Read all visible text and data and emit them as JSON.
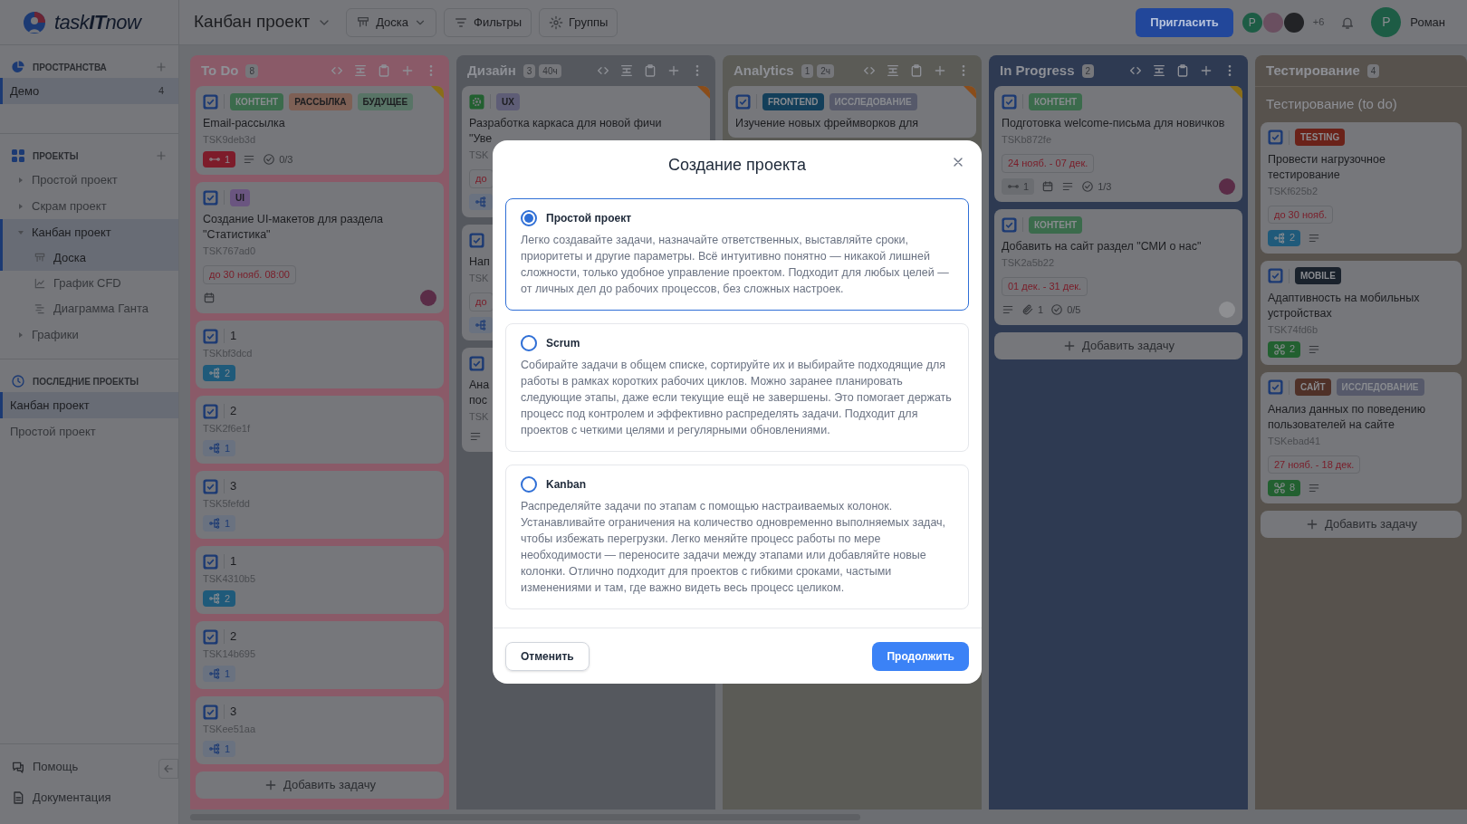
{
  "topbar": {
    "logo": "task**IT**now",
    "project_title": "Канбан проект",
    "view_button": "Доска",
    "filters_button": "Фильтры",
    "groups_button": "Группы",
    "invite_button": "Пригласить",
    "members": [
      {
        "kind": "letter",
        "text": "Р",
        "color": "#1d5c45"
      },
      {
        "kind": "photo",
        "color": "#6a4f60"
      },
      {
        "kind": "photo",
        "color": "#222326"
      }
    ],
    "more_members": "+6",
    "user": {
      "initial": "Р",
      "name": "Роман",
      "color": "#1d5c45"
    }
  },
  "sidebar": {
    "sections": [
      {
        "kind": "spaces",
        "title": "ПРОСТРАНСТВА",
        "addable": true,
        "items": [
          {
            "label": "Демо",
            "count": "4",
            "selected": true
          }
        ]
      },
      {
        "kind": "projects",
        "title": "ПРОЕКТЫ",
        "addable": true,
        "items": [
          {
            "label": "Простой проект",
            "expanded": false,
            "selected": false
          },
          {
            "label": "Скрам проект",
            "expanded": false,
            "selected": false
          },
          {
            "label": "Канбан проект",
            "expanded": true,
            "selected": true,
            "children": [
              {
                "kind": "board",
                "label": "Доска",
                "selected": true
              },
              {
                "kind": "chart",
                "label": "График CFD",
                "selected": false
              },
              {
                "kind": "gantt",
                "label": "Диаграмма Ганта",
                "selected": false
              }
            ]
          },
          {
            "label": "Графики",
            "expanded": false,
            "selected": false
          }
        ]
      },
      {
        "kind": "recent",
        "title": "ПОСЛЕДНИЕ ПРОЕКТЫ",
        "addable": false,
        "items": [
          {
            "label": "Канбан проект",
            "selected": true
          },
          {
            "label": "Простой проект",
            "selected": false
          }
        ]
      }
    ],
    "footer": [
      {
        "kind": "help",
        "label": "Помощь"
      },
      {
        "kind": "docs",
        "label": "Документация"
      }
    ]
  },
  "columns": [
    {
      "title": "To Do",
      "count": "8",
      "color": "#8a5a68",
      "actions": true,
      "cards": [
        {
          "kind": "task",
          "tags": [
            {
              "text": "КОНТЕНТ",
              "color": "#3b6b4c"
            },
            {
              "text": "РАССЫЛКА",
              "color": "#7e6055"
            },
            {
              "text": "БУДУЩЕЕ",
              "color": "#587466"
            }
          ],
          "title": "Email-рассылка",
          "code": "TSK9deb3d",
          "flag": {
            "color": "#8a6d18"
          },
          "footer": [
            {
              "kind": "links",
              "count": "1",
              "color": "#7d1c2a",
              "filled": true
            },
            {
              "kind": "description"
            },
            {
              "kind": "checklist",
              "count": "0/3"
            }
          ]
        },
        {
          "kind": "task",
          "tags": [
            {
              "text": "UI",
              "color": "#6a5580"
            }
          ],
          "title": "Создание UI-макетов для раздела \"Статистика\"",
          "code": "TSK767ad0",
          "due": "до 30 нояб. 08:00",
          "footer": [
            {
              "kind": "calendar"
            },
            {
              "kind": "avatar",
              "color": "#5a2c47"
            }
          ]
        },
        {
          "kind": "short",
          "title": "1",
          "code": "TSKbf3dcd",
          "footer": [
            {
              "kind": "subtasks",
              "count": "2",
              "color": "#1f5a7a",
              "filled": true
            }
          ]
        },
        {
          "kind": "short",
          "title": "2",
          "code": "TSK2f6e1f",
          "footer": [
            {
              "kind": "subtasks",
              "count": "1",
              "color": "#6a7280",
              "filled": false
            }
          ]
        },
        {
          "kind": "short",
          "title": "3",
          "code": "TSK5fefdd",
          "footer": [
            {
              "kind": "subtasks",
              "count": "1",
              "color": "#6a7280",
              "filled": false
            }
          ]
        },
        {
          "kind": "short",
          "title": "1",
          "code": "TSK4310b5",
          "footer": [
            {
              "kind": "subtasks",
              "count": "2",
              "color": "#1f5a7a",
              "filled": true
            }
          ]
        },
        {
          "kind": "short",
          "title": "2",
          "code": "TSK14b695",
          "footer": [
            {
              "kind": "subtasks",
              "count": "1",
              "color": "#6a7280",
              "filled": false
            }
          ]
        },
        {
          "kind": "short",
          "title": "3",
          "code": "TSKee51aa",
          "footer": [
            {
              "kind": "subtasks",
              "count": "1",
              "color": "#6a7280",
              "filled": false
            }
          ]
        }
      ],
      "add_label": "Добавить задачу"
    },
    {
      "title": "Дизайн",
      "count": "3",
      "time": "40ч",
      "color": "#55585e",
      "actions": true,
      "cards": [
        {
          "kind": "story",
          "tags": [
            {
              "text": "UX",
              "color": "#5e5d76"
            }
          ],
          "title": "Разработка каркаса для новой фичи\n\"Уве",
          "code": "TSK",
          "due": "до",
          "flag": {
            "color": "#8a4d1a"
          },
          "footer": [
            {
              "kind": "subtasks",
              "color": "#6a7280",
              "filled": false
            }
          ]
        },
        {
          "kind": "task",
          "title": "Нап",
          "code": "TSK",
          "due": "до",
          "footer": [
            {
              "kind": "subtasks",
              "color": "#6a7280",
              "filled": false
            }
          ]
        },
        {
          "kind": "task",
          "title": "Ана\nпос",
          "code": "TSK",
          "footer": [
            {
              "kind": "description"
            }
          ]
        }
      ]
    },
    {
      "title": "Analytics",
      "count": "1",
      "time": "2ч",
      "color": "#5b5b56",
      "actions": true,
      "cards": [
        {
          "kind": "task",
          "tags": [
            {
              "text": "FRONTEND",
              "color": "#133f5a"
            },
            {
              "text": "ИССЛЕДОВАНИЕ",
              "color": "#56596a"
            }
          ],
          "title": "Изучение новых фреймворков для",
          "flag": {
            "color": "#8a4d1a"
          }
        }
      ]
    },
    {
      "title": "In Progress",
      "count": "2",
      "color": "#2e3a52",
      "actions": true,
      "cards": [
        {
          "kind": "task",
          "tags": [
            {
              "text": "КОНТЕНТ",
              "color": "#3b6b4c"
            }
          ],
          "title": "Подготовка welcome-письма для новичков",
          "code": "TSKb872fe",
          "due": "24 нояб. - 07 дек.",
          "flag": {
            "color": "#8a6d18"
          },
          "footer": [
            {
              "kind": "links",
              "count": "1",
              "color": "#6b6d71",
              "filled": false
            },
            {
              "kind": "calendar"
            },
            {
              "kind": "description"
            },
            {
              "kind": "checklist",
              "count": "1/3"
            },
            {
              "kind": "avatar",
              "color": "#5a2c47"
            }
          ]
        },
        {
          "kind": "task",
          "tags": [
            {
              "text": "КОНТЕНТ",
              "color": "#3b6b4c"
            }
          ],
          "title": "Добавить на сайт раздел \"СМИ о нас\"",
          "code": "TSK2a5b22",
          "due": "01 дек. - 31 дек.",
          "footer": [
            {
              "kind": "description"
            },
            {
              "kind": "attachments",
              "count": "1"
            },
            {
              "kind": "checklist",
              "count": "0/5"
            },
            {
              "kind": "avatar",
              "color": "#8e8f92"
            }
          ]
        }
      ],
      "add_label": "Добавить задачу"
    },
    {
      "title": "Тестирование",
      "count": "4",
      "color": "#57524d",
      "actions": false,
      "group": "Тестирование (to do)",
      "cards": [
        {
          "kind": "task",
          "tags": [
            {
              "text": "TESTING",
              "color": "#6a2219"
            }
          ],
          "title": "Провести нагрузочное тестирование",
          "code": "TSKf625b2",
          "due": "до 30 нояб.",
          "footer": [
            {
              "kind": "subtasks",
              "count": "2",
              "color": "#1f5a7a",
              "filled": true
            },
            {
              "kind": "description"
            }
          ]
        },
        {
          "kind": "task",
          "tags": [
            {
              "text": "MOBILE",
              "color": "#1a222c"
            }
          ],
          "title": "Адаптивность на мобильных устройствах",
          "code": "TSK74fd6b",
          "footer": [
            {
              "kind": "related",
              "count": "2",
              "color": "#226030",
              "filled": true
            },
            {
              "kind": "description"
            }
          ]
        },
        {
          "kind": "task",
          "tags": [
            {
              "text": "САЙТ",
              "color": "#4f3128"
            },
            {
              "text": "ИССЛЕДОВАНИЕ",
              "color": "#56596a"
            }
          ],
          "title": "Анализ данных по поведению пользователей на сайте",
          "code": "TSKebad41",
          "due": "27 нояб. - 18 дек.",
          "footer": [
            {
              "kind": "related",
              "count": "8",
              "color": "#226030",
              "filled": true
            },
            {
              "kind": "description"
            }
          ]
        }
      ],
      "add_label": "Добавить задачу"
    }
  ],
  "modal": {
    "title": "Создание проекта",
    "options": [
      {
        "name": "Простой проект",
        "selected": true,
        "description": "Легко создавайте задачи, назначайте ответственных, выставляйте сроки, приоритеты и другие параметры. Всё интуитивно понятно — никакой лишней сложности, только удобное управление проектом. Подходит для любых целей — от личных дел до рабочих процессов, без сложных настроек."
      },
      {
        "name": "Scrum",
        "selected": false,
        "description": "Собирайте задачи в общем списке, сортируйте их и выбирайте подходящие для работы в рамках коротких рабочих циклов. Можно заранее планировать следующие этапы, даже если текущие ещё не завершены. Это помогает держать процесс под контролем и эффективно распределять задачи. Подходит для проектов с четкими целями и регулярными обновлениями."
      },
      {
        "name": "Kanban",
        "selected": false,
        "description": "Распределяйте задачи по этапам с помощью настраиваемых колонок. Устанавливайте ограничения на количество одновременно выполняемых задач, чтобы избежать перегрузки. Легко меняйте процесс работы по мере необходимости — переносите задачи между этапами или добавляйте новые колонки. Отлично подходит для проектов с гибкими сроками, частыми изменениями и там, где важно видеть весь процесс целиком."
      }
    ],
    "cancel_button": "Отменить",
    "continue_button": "Продолжить"
  }
}
